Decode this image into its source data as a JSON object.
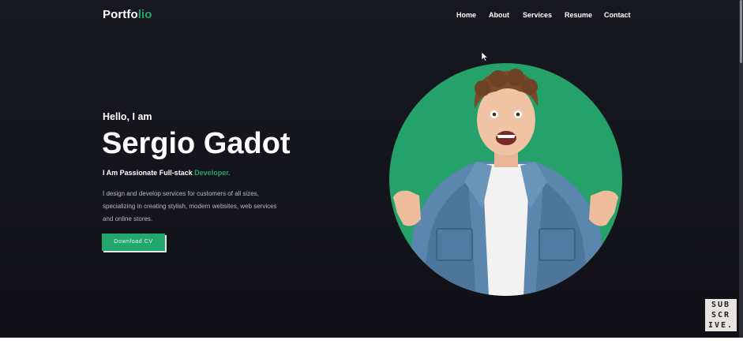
{
  "header": {
    "logo": {
      "part1": "Portfo",
      "part2": "lio"
    },
    "nav": [
      {
        "label": "Home"
      },
      {
        "label": "About"
      },
      {
        "label": "Services"
      },
      {
        "label": "Resume"
      },
      {
        "label": "Contact"
      }
    ]
  },
  "hero": {
    "greeting": "Hello, I am",
    "name": "Sergio Gadot",
    "tagline_prefix": "I Am Passionate Full-stack ",
    "tagline_accent": "Developer.",
    "description_lines": [
      "I design and develop services for customers of all sizes,",
      "specializing in creating stylish, modern websites, web services",
      "and online stores."
    ],
    "cta_label": "Download CV"
  },
  "overlay": {
    "subscribe_lines": [
      "SUB",
      "SCR",
      "IVE."
    ]
  },
  "colors": {
    "accent": "#21a76a",
    "background": "#15151c",
    "text": "#ffffff"
  }
}
